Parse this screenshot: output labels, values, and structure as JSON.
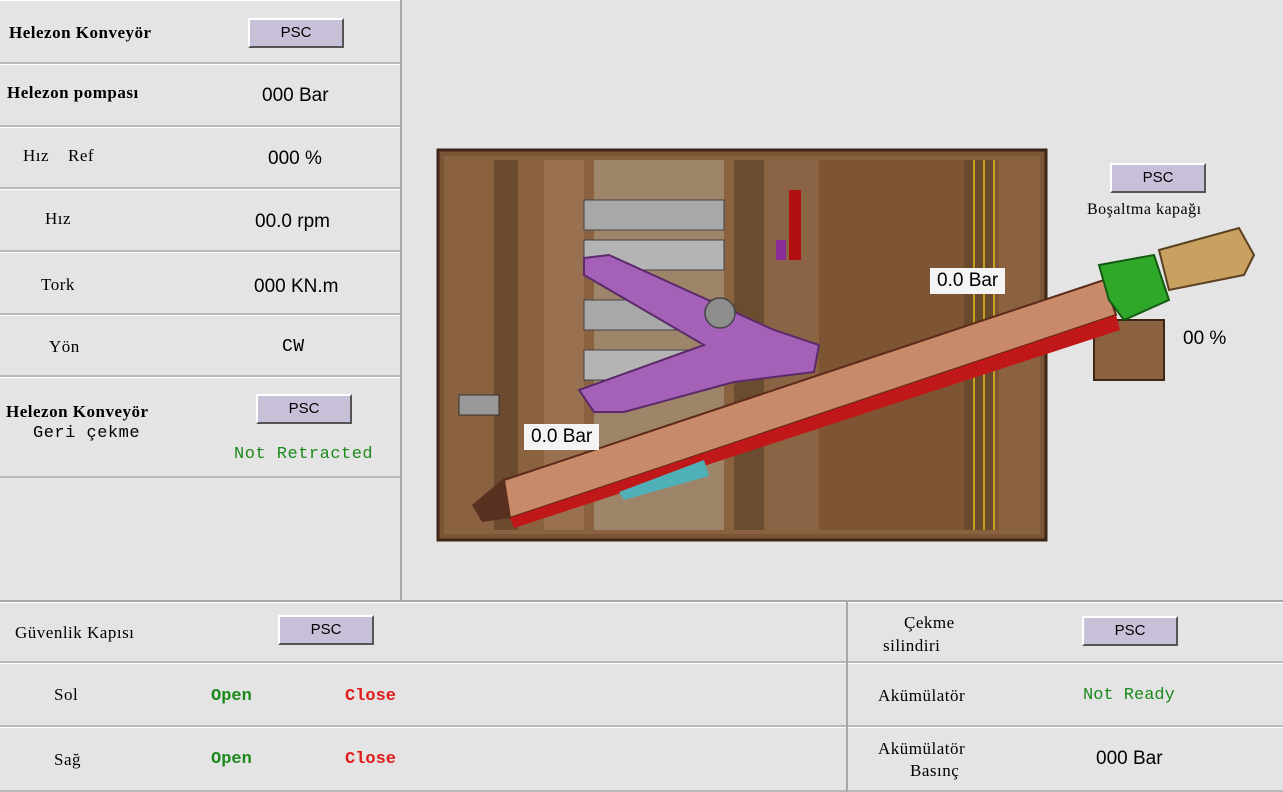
{
  "colors": {
    "background": "#e4e4e4",
    "button": "#c8c0d8",
    "status_green": "#1b8a1b",
    "status_red": "#e21b1b"
  },
  "left": {
    "title": "Helezon  Konveyör",
    "title_button": "PSC",
    "rows": [
      {
        "label": "Helezon pompası",
        "value": "000 Bar"
      },
      {
        "label": "Hız    Ref",
        "value": "000 %"
      },
      {
        "label": "Hız",
        "value": "00.0 rpm"
      },
      {
        "label": "Tork",
        "value": "000 KN.m"
      },
      {
        "label": "Yön",
        "value": "CW"
      }
    ],
    "retract": {
      "label_line1": "Helezon Konveyör",
      "label_line2": "Geri çekme",
      "button": "PSC",
      "status": "Not Retracted"
    }
  },
  "drawing": {
    "pressure_upper": "0.0 Bar",
    "pressure_lower": "0.0 Bar",
    "gate_button": "PSC",
    "gate_label": "Boşaltma kapağı",
    "gate_percent": "00 %"
  },
  "safety": {
    "title": "Güvenlik Kapısı",
    "button": "PSC",
    "rows": [
      {
        "label": "Sol",
        "open": "Open",
        "close": "Close"
      },
      {
        "label": "Sağ",
        "open": "Open",
        "close": "Close"
      }
    ]
  },
  "cylinder": {
    "title_line1": "Çekme",
    "title_line2": "silindiri",
    "button": "PSC",
    "accumulator_label": "Akümülatör",
    "accumulator_status": "Not Ready",
    "pressure_label_line1": "Akümülatör",
    "pressure_label_line2": "Basınç",
    "pressure_value": "000 Bar"
  }
}
